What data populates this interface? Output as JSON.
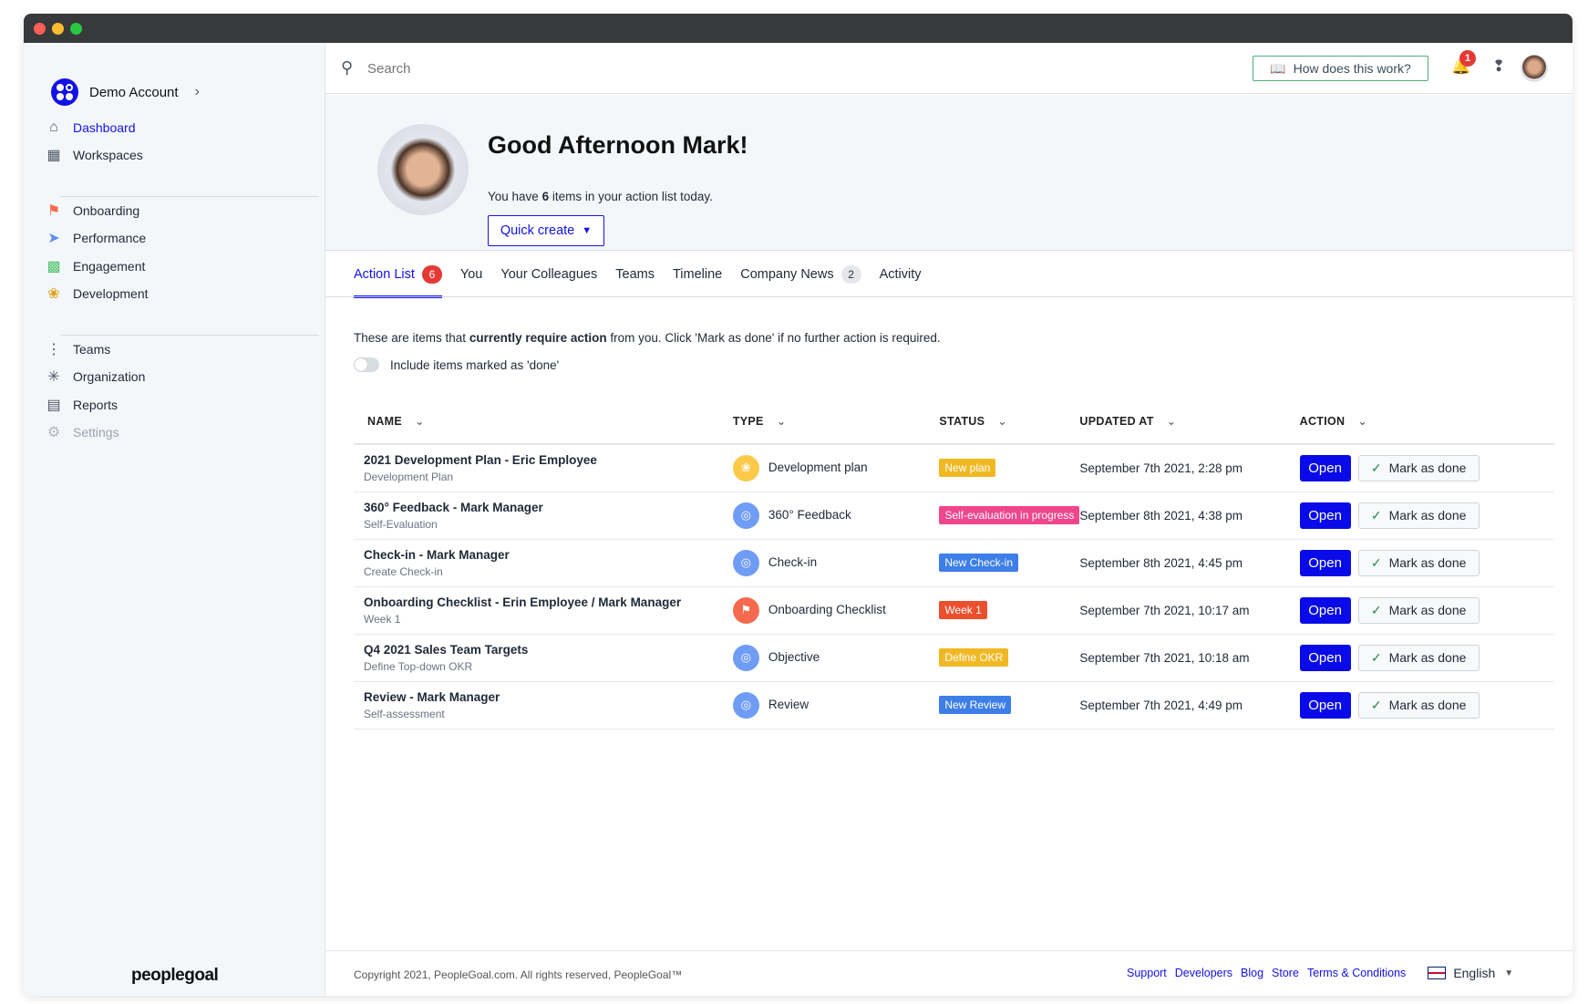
{
  "colors": {
    "accent": "#1212e6",
    "open_button": "#0a0ae8",
    "badge_red": "#e53935"
  },
  "sidebar": {
    "account": "Demo Account",
    "items": [
      {
        "label": "Dashboard",
        "icon": "home-icon",
        "active": true
      },
      {
        "label": "Workspaces",
        "icon": "grid-icon"
      },
      {
        "label": "Onboarding",
        "icon": "flag-icon"
      },
      {
        "label": "Performance",
        "icon": "paper-plane-icon"
      },
      {
        "label": "Engagement",
        "icon": "puzzle-icon"
      },
      {
        "label": "Development",
        "icon": "sprout-icon"
      },
      {
        "label": "Teams",
        "icon": "org-dots-icon"
      },
      {
        "label": "Organization",
        "icon": "network-icon"
      },
      {
        "label": "Reports",
        "icon": "table-icon"
      },
      {
        "label": "Settings",
        "icon": "gear-icon",
        "disabled": true
      }
    ],
    "brand": "peoplegoal"
  },
  "header": {
    "search_placeholder": "Search",
    "help_button": "How does this work?",
    "notifications_count": "1"
  },
  "hero": {
    "greeting": "Good Afternoon Mark!",
    "summary_pre": "You have ",
    "summary_count": "6",
    "summary_post": " items in your action list today.",
    "quick_create": "Quick create"
  },
  "tabs": [
    {
      "label": "Action List",
      "badge": "6"
    },
    {
      "label": "You"
    },
    {
      "label": "Your Colleagues"
    },
    {
      "label": "Teams"
    },
    {
      "label": "Timeline"
    },
    {
      "label": "Company News",
      "badge": "2"
    },
    {
      "label": "Activity"
    }
  ],
  "action_list": {
    "intro_pre": "These are items that ",
    "intro_bold": "currently require action",
    "intro_post": " from you. Click 'Mark as done' if no further action is required.",
    "toggle_label": "Include items marked as 'done'",
    "toggle_on": false,
    "columns": [
      "NAME",
      "TYPE",
      "STATUS",
      "UPDATED AT",
      "ACTION"
    ],
    "rows": [
      {
        "name": "2021 Development Plan - Eric Employee",
        "subtitle": "Development Plan",
        "type": "Development plan",
        "type_color": "#fcc94a",
        "type_icon": "sprout-icon",
        "status": "New plan",
        "status_color": "#f0b924",
        "updated": "September 7th 2021, 2:28 pm"
      },
      {
        "name": "360° Feedback - Mark Manager",
        "subtitle": "Self-Evaluation",
        "type": "360° Feedback",
        "type_color": "#6f9cf4",
        "type_icon": "target-icon",
        "status": "Self-evaluation in progress",
        "status_color": "#f0468c",
        "updated": "September 8th 2021, 4:38 pm"
      },
      {
        "name": "Check-in - Mark Manager",
        "subtitle": "Create Check-in",
        "type": "Check-in",
        "type_color": "#6f9cf4",
        "type_icon": "target-icon",
        "status": "New Check-in",
        "status_color": "#3d7ee8",
        "updated": "September 8th 2021, 4:45 pm"
      },
      {
        "name": "Onboarding Checklist - Erin Employee / Mark Manager",
        "subtitle": "Week 1",
        "type": "Onboarding Checklist",
        "type_color": "#f56a4f",
        "type_icon": "flag-icon",
        "status": "Week 1",
        "status_color": "#eb4f2e",
        "updated": "September 7th 2021, 10:17 am"
      },
      {
        "name": "Q4 2021 Sales Team Targets",
        "subtitle": "Define Top-down OKR",
        "type": "Objective",
        "type_color": "#6f9cf4",
        "type_icon": "target-icon",
        "status": "Define OKR",
        "status_color": "#f0b924",
        "updated": "September 7th 2021, 10:18 am"
      },
      {
        "name": "Review - Mark Manager",
        "subtitle": "Self-assessment",
        "type": "Review",
        "type_color": "#6f9cf4",
        "type_icon": "target-icon",
        "status": "New Review",
        "status_color": "#3d7ee8",
        "updated": "September 7th 2021, 4:49 pm"
      }
    ],
    "open_label": "Open",
    "done_label": "Mark as done"
  },
  "footer": {
    "copyright": "Copyright 2021, PeopleGoal.com. All rights reserved, PeopleGoal™",
    "links": [
      "Support",
      "Developers",
      "Blog",
      "Store",
      "Terms & Conditions"
    ],
    "language": "English"
  }
}
